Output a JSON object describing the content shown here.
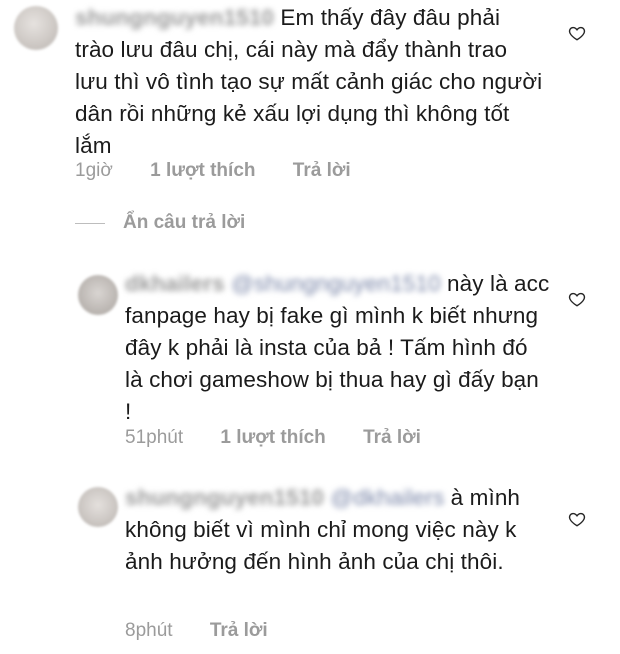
{
  "comments": [
    {
      "username": "shungnguyen1510",
      "mention": "",
      "text": "Em thấy đây đâu phải trào lưu đâu chị, cái này mà đẩy thành trao lưu thì vô tình tạo sự mất cảnh giác cho người dân rồi những kẻ xấu lợi dụng thì không tốt lắm",
      "time": "1giờ",
      "likes": "1 lượt thích",
      "reply": "Trả lời"
    },
    {
      "username": "dkhailers",
      "mention": "@shungnguyen1510",
      "text": "này là acc fanpage hay bị fake gì mình k biết nhưng đây k phải là insta của bả ! Tấm hình đó là chơi gameshow bị thua hay gì đấy bạn !",
      "time": "51phút",
      "likes": "1 lượt thích",
      "reply": "Trả lời"
    },
    {
      "username": "shungnguyen1510",
      "mention": "@dkhailers",
      "text": "à mình không biết vì mình chỉ mong việc này k ảnh hưởng đến hình ảnh của chị thôi.",
      "time": "8phút",
      "likes": "",
      "reply": "Trả lời"
    }
  ],
  "hide_replies_label": "Ẩn câu trả lời",
  "icons": {
    "like": "heart-outline-icon"
  },
  "colors": {
    "text": "#1b1b1b",
    "meta": "#9b9b9b"
  }
}
